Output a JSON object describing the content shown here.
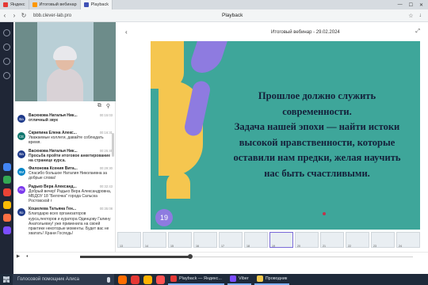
{
  "browser": {
    "tabs": [
      {
        "label": "Яндекс",
        "favicon": "#e53935",
        "active": false
      },
      {
        "label": "Итоговый вебинар",
        "favicon": "#ff9800",
        "active": false
      },
      {
        "label": "Playback",
        "favicon": "#3f51b5",
        "active": true
      }
    ],
    "url": "bbb.clever-lab.pro",
    "page_title": "Playback"
  },
  "player": {
    "webinar_title": "Итоговый вебинар - 29.02.2024",
    "progress": 0.33
  },
  "chat": {
    "messages": [
      {
        "initials": "Ва",
        "name": "Васюкова Наталья Ник...",
        "time": "00:15:03",
        "text": "отличный звук",
        "bold": true,
        "color": "#1e3a8a"
      },
      {
        "initials": "СЕ",
        "name": "Скрипина Елена Алекс...",
        "time": "00:16:31",
        "text": "Уважаемые коллеги, давайте соблюдать время.",
        "bold": false,
        "color": "#0f766e"
      },
      {
        "initials": "Ва",
        "name": "Васюкова Наталья Ник...",
        "time": "00:25:45",
        "text": "Просьба пройти итоговое анкетирование на странице курса.",
        "bold": true,
        "color": "#1e3a8a"
      },
      {
        "initials": "ФИ",
        "name": "Филонова Ксения Вита...",
        "time": "00:29:30",
        "text": "Спасибо большое Наталия Николаевна за добрые слова!",
        "bold": false,
        "color": "#0284c7"
      },
      {
        "initials": "Ра",
        "name": "Радько Вера Александ...",
        "time": "00:32:43",
        "text": "Добрый вечер! Радько Вера Александровна, МБДОУ 18 \"Белочка\" города Сальска Ростовской г",
        "bold": false,
        "color": "#7c3aed"
      },
      {
        "initials": "Ко",
        "name": "Кошелева Татьяна Ген...",
        "time": "00:35:08",
        "text": "Благодарю всех организаторов курса,лекторов и куратора Одинцову Галину Анатольевну! уже применила на своей практике некоторые моменты. Будет вас не хватать! Храни Господь!",
        "bold": false,
        "color": "#1e3a8a"
      }
    ]
  },
  "slide": {
    "lines": [
      "Прошлое должно служить",
      "современности.",
      "Задача нашей эпохи — найти истоки",
      "высокой нравственности, которые",
      "оставили нам предки, желая научить",
      "нас быть счастливыми."
    ],
    "page_number": "19"
  },
  "thumbnails": [
    {
      "label": "13"
    },
    {
      "label": "14"
    },
    {
      "label": "15"
    },
    {
      "label": "16"
    },
    {
      "label": "17"
    },
    {
      "label": "18"
    },
    {
      "label": "19"
    },
    {
      "label": "20"
    },
    {
      "label": "21"
    },
    {
      "label": "22"
    },
    {
      "label": "23"
    },
    {
      "label": "24"
    }
  ],
  "taskbar": {
    "alice_label": "Голосовой помощник Алиса",
    "apps": [
      {
        "label": "Playback — Яндекс...",
        "color": "#e53935"
      },
      {
        "label": "Viber",
        "color": "#7c4dff"
      },
      {
        "label": "Проводник",
        "color": "#f2c94c"
      }
    ]
  },
  "colors": {
    "slide_bg": "#3ea69a",
    "accent_yellow": "#f5c64f",
    "accent_purple": "#8e7be0"
  }
}
